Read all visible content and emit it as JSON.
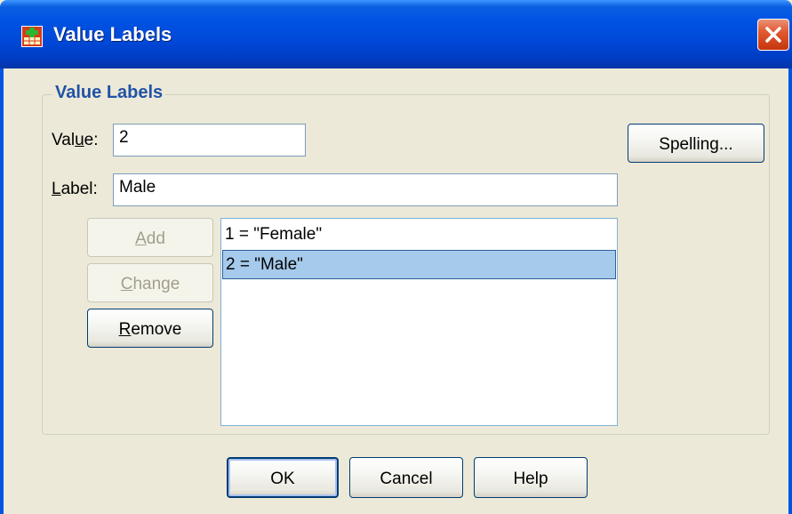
{
  "window": {
    "title": "Value Labels",
    "icon": "spss-value-labels-icon",
    "close_icon": "close-icon"
  },
  "group": {
    "legend": "Value Labels"
  },
  "value_field": {
    "label_pre": "Val",
    "label_mnemonic": "u",
    "label_post": "e:",
    "value": "2"
  },
  "label_field": {
    "label_mnemonic": "L",
    "label_post": "abel:",
    "value": "Male"
  },
  "buttons": {
    "spelling": "Spelling...",
    "add": {
      "mnemonic": "A",
      "rest": "dd",
      "enabled": false
    },
    "change": {
      "mnemonic": "C",
      "rest": "hange",
      "enabled": false
    },
    "remove": {
      "mnemonic": "R",
      "rest": "emove",
      "enabled": true
    },
    "ok": "OK",
    "cancel": "Cancel",
    "help": "Help"
  },
  "labels_list": [
    {
      "text": "1 = \"Female\"",
      "selected": false
    },
    {
      "text": "2 = \"Male\"",
      "selected": true
    }
  ],
  "colors": {
    "title_bar": "#0054e3",
    "legend_text": "#2153a6",
    "selection": "#a6caeb",
    "close_button": "#e05a31"
  }
}
